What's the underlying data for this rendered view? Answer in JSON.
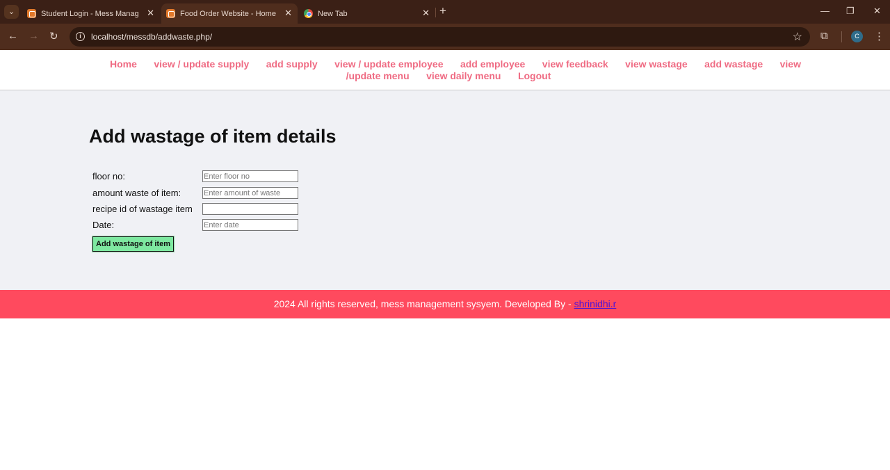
{
  "browser": {
    "tabs": [
      {
        "title": "Student Login - Mess Managem"
      },
      {
        "title": "Food Order Website - Home Pa"
      },
      {
        "title": "New Tab"
      }
    ],
    "url": "localhost/messdb/addwaste.php/",
    "profile_initial": "C"
  },
  "nav": {
    "links": [
      "Home",
      "view / update supply",
      "add supply",
      "view / update employee",
      "add employee",
      "view feedback",
      "view wastage",
      "add wastage",
      "view /update menu",
      "view daily menu",
      "Logout"
    ],
    "link_color": "#ef6b83"
  },
  "main": {
    "title": "Add wastage of item details",
    "fields": [
      {
        "label": "floor no:",
        "placeholder": "Enter floor no",
        "value": ""
      },
      {
        "label": "amount waste of item:",
        "placeholder": "Enter amount of waste",
        "value": ""
      },
      {
        "label": "recipe id of wastage item",
        "placeholder": "",
        "value": ""
      },
      {
        "label": "Date:",
        "placeholder": "Enter date",
        "value": ""
      }
    ],
    "submit_label": "Add wastage of item",
    "submit_color": "#7ee8a0"
  },
  "footer": {
    "text": "2024 All rights reserved, mess management sysyem. Developed By - ",
    "link_text": "shrinidhi.r",
    "background": "#ff4a5e"
  },
  "theme": {
    "chrome_bg": "#3b2016",
    "toolbar_bg": "#4f2d1d",
    "page_bg": "#f0f1f5"
  }
}
